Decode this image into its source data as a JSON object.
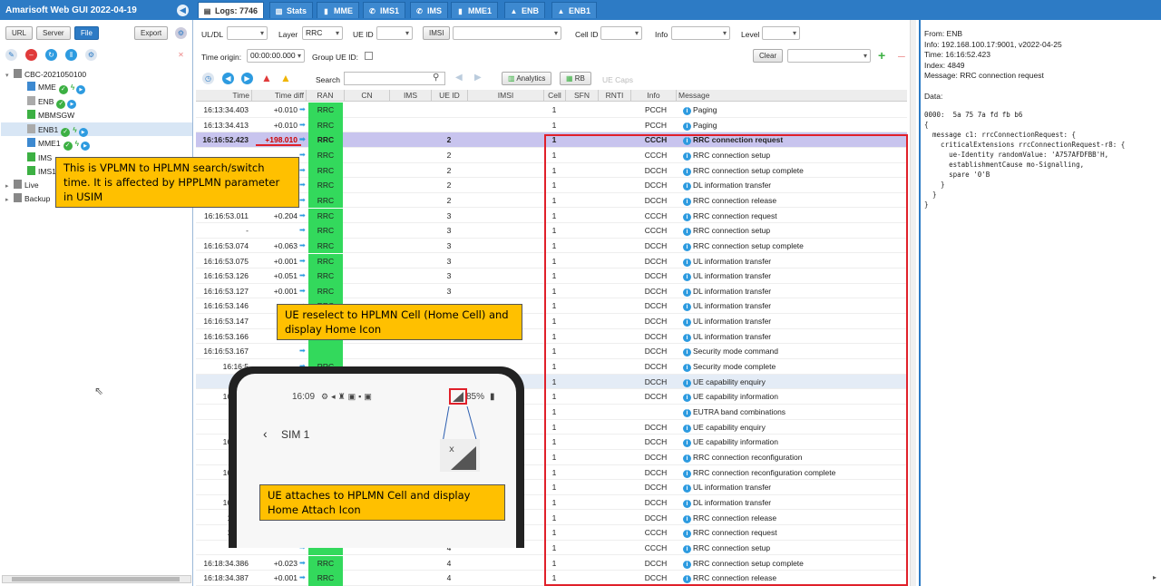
{
  "app": {
    "title": "Amarisoft Web GUI 2022-04-19",
    "collapse_icon": "chevron-left-icon"
  },
  "tabs": [
    {
      "label": "Logs: 7746",
      "icon": "list-icon"
    },
    {
      "label": "Stats",
      "icon": "chart-icon"
    },
    {
      "label": "MME",
      "icon": "server-icon"
    },
    {
      "label": "IMS1",
      "icon": "phone-icon"
    },
    {
      "label": "IMS",
      "icon": "phone-icon"
    },
    {
      "label": "MME1",
      "icon": "server-icon"
    },
    {
      "label": "ENB",
      "icon": "antenna-icon"
    },
    {
      "label": "ENB1",
      "icon": "antenna-icon"
    }
  ],
  "sidebar": {
    "buttons": {
      "url": "URL",
      "server": "Server",
      "file": "File",
      "export": "Export"
    },
    "root": "CBC-2021050100",
    "items": [
      "MME",
      "ENB",
      "MBMSGW",
      "ENB1",
      "MME1",
      "IMS",
      "IMS1"
    ],
    "groups": [
      "Live",
      "Backup"
    ]
  },
  "filters": {
    "uldl_label": "UL/DL",
    "uldl_value": "",
    "layer_label": "Layer",
    "layer_value": "RRC",
    "ueid_label": "UE ID",
    "ueid_value": "",
    "imsi_label": "IMSI",
    "imsi_value": "",
    "cellid_label": "Cell ID",
    "cellid_value": "",
    "info_label": "Info",
    "info_value": "",
    "level_label": "Level",
    "level_value": "",
    "time_origin_label": "Time origin:",
    "time_origin_value": "00:00:00.000",
    "group_ueid_label": "Group UE ID:",
    "clear_label": "Clear",
    "search_label": "Search",
    "analytics_label": "Analytics",
    "rb_label": "RB",
    "uecaps_label": "UE Caps"
  },
  "columns": [
    "Time",
    "Time diff",
    "RAN",
    "CN",
    "IMS",
    "UE ID",
    "IMSI",
    "Cell",
    "SFN",
    "RNTI",
    "Info",
    "Message"
  ],
  "rows": [
    {
      "time": "16:13:34.403",
      "diff": "+0.010",
      "ran": "RRC",
      "ue": "",
      "cell": "1",
      "info": "PCCH",
      "msg": "Paging"
    },
    {
      "time": "16:13:34.413",
      "diff": "+0.010",
      "ran": "RRC",
      "ue": "",
      "cell": "1",
      "info": "PCCH",
      "msg": "Paging"
    },
    {
      "time": "16:16:52.423",
      "diff": "+198.010",
      "ran": "RRC",
      "ue": "2",
      "cell": "1",
      "info": "CCCH",
      "msg": "RRC connection request"
    },
    {
      "time": "",
      "diff": "",
      "ran": "RRC",
      "ue": "2",
      "cell": "1",
      "info": "CCCH",
      "msg": "RRC connection setup"
    },
    {
      "time": "",
      "diff": "",
      "ran": "RRC",
      "ue": "2",
      "cell": "1",
      "info": "DCCH",
      "msg": "RRC connection setup complete"
    },
    {
      "time": "",
      "diff": "",
      "ran": "RRC",
      "ue": "2",
      "cell": "1",
      "info": "DCCH",
      "msg": "DL information transfer"
    },
    {
      "time": "",
      "diff": "",
      "ran": "RRC",
      "ue": "2",
      "cell": "1",
      "info": "DCCH",
      "msg": "RRC connection release"
    },
    {
      "time": "16:16:53.011",
      "diff": "+0.204",
      "ran": "RRC",
      "ue": "3",
      "cell": "1",
      "info": "CCCH",
      "msg": "RRC connection request"
    },
    {
      "time": "-",
      "diff": "",
      "ran": "RRC",
      "ue": "3",
      "cell": "1",
      "info": "CCCH",
      "msg": "RRC connection setup"
    },
    {
      "time": "16:16:53.074",
      "diff": "+0.063",
      "ran": "RRC",
      "ue": "3",
      "cell": "1",
      "info": "DCCH",
      "msg": "RRC connection setup complete"
    },
    {
      "time": "16:16:53.075",
      "diff": "+0.001",
      "ran": "RRC",
      "ue": "3",
      "cell": "1",
      "info": "DCCH",
      "msg": "UL information transfer"
    },
    {
      "time": "16:16:53.126",
      "diff": "+0.051",
      "ran": "RRC",
      "ue": "3",
      "cell": "1",
      "info": "DCCH",
      "msg": "UL information transfer"
    },
    {
      "time": "16:16:53.127",
      "diff": "+0.001",
      "ran": "RRC",
      "ue": "3",
      "cell": "1",
      "info": "DCCH",
      "msg": "DL information transfer"
    },
    {
      "time": "16:16:53.146",
      "diff": "",
      "ran": "RRC",
      "ue": "",
      "cell": "1",
      "info": "DCCH",
      "msg": "UL information transfer"
    },
    {
      "time": "16:16:53.147",
      "diff": "",
      "ran": "",
      "ue": "",
      "cell": "1",
      "info": "DCCH",
      "msg": "UL information transfer"
    },
    {
      "time": "16:16:53.166",
      "diff": "",
      "ran": "",
      "ue": "",
      "cell": "1",
      "info": "DCCH",
      "msg": "UL information transfer"
    },
    {
      "time": "16:16:53.167",
      "diff": "",
      "ran": "",
      "ue": "",
      "cell": "1",
      "info": "DCCH",
      "msg": "Security mode command"
    },
    {
      "time": "16:16:5",
      "diff": "",
      "ran": "RRC",
      "ue": "",
      "cell": "1",
      "info": "DCCH",
      "msg": "Security mode complete"
    },
    {
      "time": "",
      "diff": "",
      "ran": "",
      "ue": "",
      "cell": "1",
      "info": "DCCH",
      "msg": "UE capability enquiry"
    },
    {
      "time": "16:16:5",
      "diff": "",
      "ran": "",
      "ue": "",
      "cell": "1",
      "info": "DCCH",
      "msg": "UE capability information"
    },
    {
      "time": "",
      "diff": "",
      "ran": "",
      "ue": "",
      "cell": "1",
      "info": "",
      "msg": "EUTRA band combinations"
    },
    {
      "time": "",
      "diff": "",
      "ran": "",
      "ue": "",
      "cell": "1",
      "info": "DCCH",
      "msg": "UE capability enquiry"
    },
    {
      "time": "16:16:5",
      "diff": "",
      "ran": "",
      "ue": "",
      "cell": "1",
      "info": "DCCH",
      "msg": "UE capability information"
    },
    {
      "time": "",
      "diff": "",
      "ran": "",
      "ue": "",
      "cell": "1",
      "info": "DCCH",
      "msg": "RRC connection reconfiguration"
    },
    {
      "time": "16:16:5",
      "diff": "",
      "ran": "",
      "ue": "",
      "cell": "1",
      "info": "DCCH",
      "msg": "RRC connection reconfiguration complete"
    },
    {
      "time": "",
      "diff": "",
      "ran": "",
      "ue": "",
      "cell": "1",
      "info": "DCCH",
      "msg": "UL information transfer"
    },
    {
      "time": "16:16:5",
      "diff": "",
      "ran": "",
      "ue": "",
      "cell": "1",
      "info": "DCCH",
      "msg": "DL information transfer"
    },
    {
      "time": "16:17:",
      "diff": "",
      "ran": "",
      "ue": "",
      "cell": "1",
      "info": "DCCH",
      "msg": "RRC connection release"
    },
    {
      "time": "16:18:",
      "diff": "",
      "ran": "",
      "ue": "",
      "cell": "1",
      "info": "CCCH",
      "msg": "RRC connection request"
    },
    {
      "time": "",
      "diff": "",
      "ran": "",
      "ue": "4",
      "cell": "1",
      "info": "CCCH",
      "msg": "RRC connection setup"
    },
    {
      "time": "16:18:34.386",
      "diff": "+0.023",
      "ran": "RRC",
      "ue": "4",
      "cell": "1",
      "info": "DCCH",
      "msg": "RRC connection setup complete"
    },
    {
      "time": "16:18:34.387",
      "diff": "+0.001",
      "ran": "RRC",
      "ue": "4",
      "cell": "1",
      "info": "DCCH",
      "msg": "RRC connection release"
    }
  ],
  "details": {
    "from": "From: ENB",
    "info": "Info: 192.168.100.17:9001, v2022-04-25",
    "time": "Time: 16:16:52.423",
    "index": "Index: 4849",
    "message": "Message: RRC connection request",
    "data_label": "Data:",
    "hex": "0000:  5a 75 7a fd fb b6",
    "decoded": "{\n  message c1: rrcConnectionRequest: {\n    criticalExtensions rrcConnectionRequest-r8: {\n      ue-Identity randomValue: 'A757AFDFBB'H,\n      establishmentCause mo-Signalling,\n      spare '0'B\n    }\n  }\n}"
  },
  "phone": {
    "clock": "16:09",
    "battery": "85%",
    "sim": "SIM 1"
  },
  "callouts": {
    "c1": "This is VPLMN to HPLMN search/switch time. It is affected by HPPLMN parameter in USIM",
    "c2": "UE reselect to HPLMN Cell (Home Cell) and display Home Icon",
    "c3": "UE attaches to HPLMN Cell and display Home Attach Icon"
  }
}
